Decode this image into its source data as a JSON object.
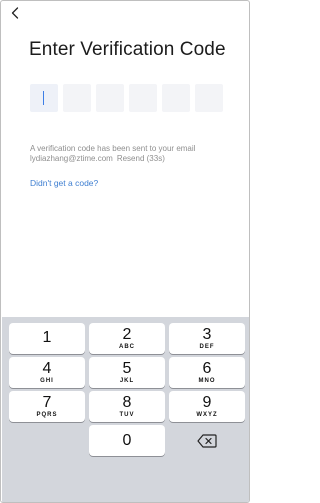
{
  "header": {
    "back_icon": "chevron-left-icon"
  },
  "title": "Enter Verification Code",
  "code": {
    "digits": [
      "",
      "",
      "",
      "",
      "",
      ""
    ],
    "active_index": 0,
    "accent": "#3d7ee6"
  },
  "info": {
    "message": "A verification code has been sent to your email",
    "email": "lydiazhang@ztime.com",
    "resend": "Resend (33s)"
  },
  "help_link": "Didn't get a code?",
  "keypad": {
    "keys": [
      {
        "num": "1",
        "letters": ""
      },
      {
        "num": "2",
        "letters": "ABC"
      },
      {
        "num": "3",
        "letters": "DEF"
      },
      {
        "num": "4",
        "letters": "GHI"
      },
      {
        "num": "5",
        "letters": "JKL"
      },
      {
        "num": "6",
        "letters": "MNO"
      },
      {
        "num": "7",
        "letters": "PQRS"
      },
      {
        "num": "8",
        "letters": "TUV"
      },
      {
        "num": "9",
        "letters": "WXYZ"
      },
      {
        "num": "0",
        "letters": ""
      }
    ],
    "delete_icon": "backspace-icon"
  }
}
